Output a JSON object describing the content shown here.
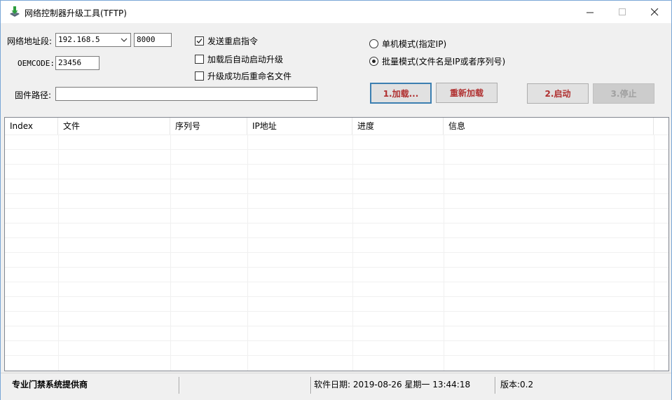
{
  "window": {
    "title": "网络控制器升级工具(TFTP)",
    "app_icon": "download-arrow-icon",
    "minimize_glyph": "—",
    "maximize_glyph": "☐",
    "close_glyph": "✕"
  },
  "form": {
    "network_label": "网络地址段:",
    "network_value": "192.168.5",
    "port_value": "8000",
    "oemcode_label": "OEMCODE:",
    "oemcode_value": "23456",
    "firmware_label": "固件路径:",
    "firmware_value": "",
    "options": {
      "send_reboot": {
        "label": "发送重启指令",
        "checked": true
      },
      "auto_start": {
        "label": "加载后自动启动升级",
        "checked": false
      },
      "rename_after": {
        "label": "升级成功后重命名文件",
        "checked": false
      }
    },
    "mode": {
      "single": {
        "label": "单机模式(指定IP)",
        "selected": false
      },
      "batch": {
        "label": "批量模式(文件名是IP或者序列号)",
        "selected": true
      }
    }
  },
  "buttons": {
    "load": "1.加载...",
    "reload": "重新加载",
    "start": "2.启动",
    "stop": "3.停止"
  },
  "table": {
    "columns": [
      "Index",
      "文件",
      "序列号",
      "IP地址",
      "进度",
      "信息"
    ],
    "rows": []
  },
  "statusbar": {
    "vendor": "专业门禁系统提供商",
    "date": "软件日期: 2019-08-26 星期一 13:44:18",
    "version": "版本:0.2"
  },
  "colors": {
    "button_text": "#b03030",
    "focus_border": "#3c7fb1",
    "disabled_text": "#a0a0a0"
  }
}
